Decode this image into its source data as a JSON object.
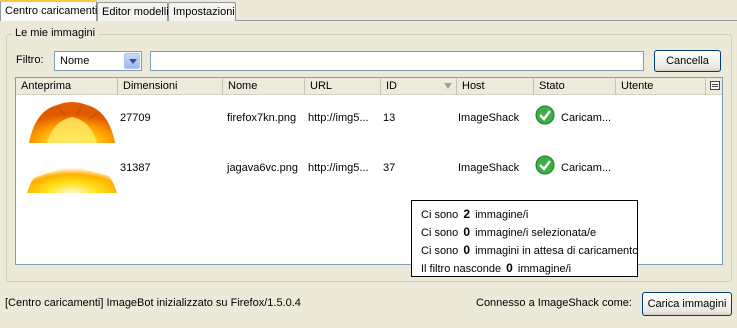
{
  "tabs": [
    {
      "label": "Centro caricamenti",
      "active": true
    },
    {
      "label": "Editor modelli",
      "active": false
    },
    {
      "label": "Impostazioni",
      "active": false
    }
  ],
  "group": {
    "title": "Le mie immagini"
  },
  "filter": {
    "label": "Filtro:",
    "selected": "Nome",
    "value": "",
    "cancel_label": "Cancella"
  },
  "table": {
    "columns": [
      "Anteprima",
      "Dimensioni",
      "Nome",
      "URL",
      "ID",
      "Host",
      "Stato",
      "Utente"
    ],
    "rows": [
      {
        "size": "27709",
        "name": "firefox7kn.png",
        "url": "http://img5...",
        "id": "13",
        "host": "ImageShack",
        "status": "Caricam...",
        "user": ""
      },
      {
        "size": "31387",
        "name": "jagava6vc.png",
        "url": "http://img5...",
        "id": "37",
        "host": "ImageShack",
        "status": "Caricam...",
        "user": ""
      }
    ]
  },
  "tooltip": {
    "lines": [
      {
        "pre": "Ci sono",
        "num": "2",
        "post": "immagine/i"
      },
      {
        "pre": "Ci sono",
        "num": "0",
        "post": "immagine/i selezionata/e"
      },
      {
        "pre": "Ci sono",
        "num": "0",
        "post": "immagini in attesa di caricamento"
      },
      {
        "pre": "Il filtro nasconde",
        "num": "0",
        "post": "immagine/i"
      }
    ]
  },
  "statusbar": {
    "text": "[Centro caricamenti] ImageBot inizializzato su Firefox/1.5.0.4",
    "connect": "Connesso a ImageShack come:",
    "upload_label": "Carica immagini"
  },
  "colors": {
    "accent_tab": "#ffc83c",
    "status_ok": "#2fa52f"
  }
}
